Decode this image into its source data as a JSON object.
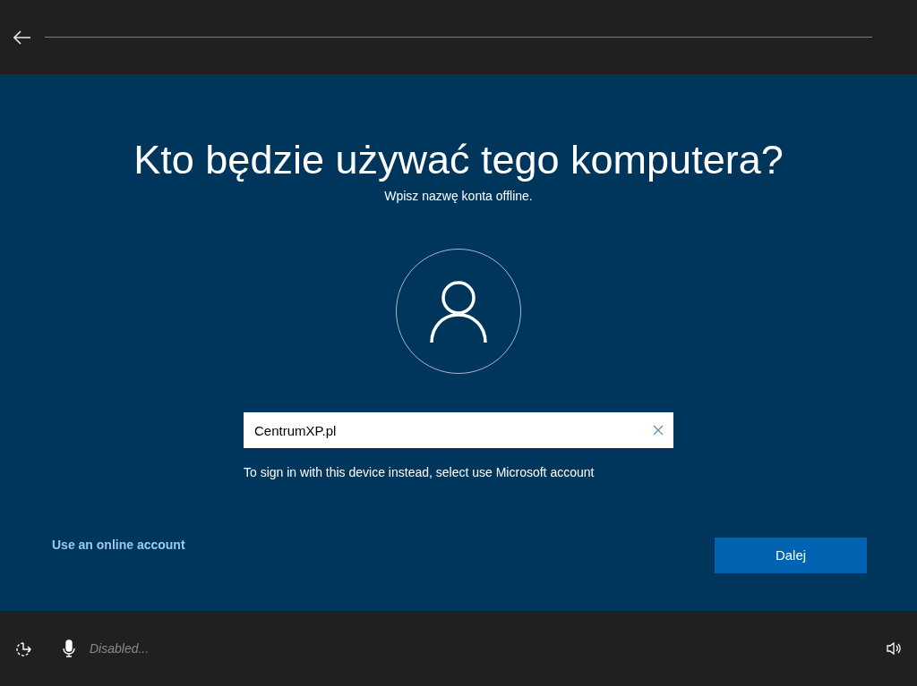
{
  "title": "Kto będzie używać tego komputera?",
  "subtitle": "Wpisz nazwę konta offline.",
  "name_field": {
    "value": "CentrumXP.pl"
  },
  "hint": "To sign in with this device instead, select use Microsoft account",
  "online_account_link": "Use an online account",
  "next_button": "Dalej",
  "status_bar": {
    "voice_status": "Disabled..."
  }
}
